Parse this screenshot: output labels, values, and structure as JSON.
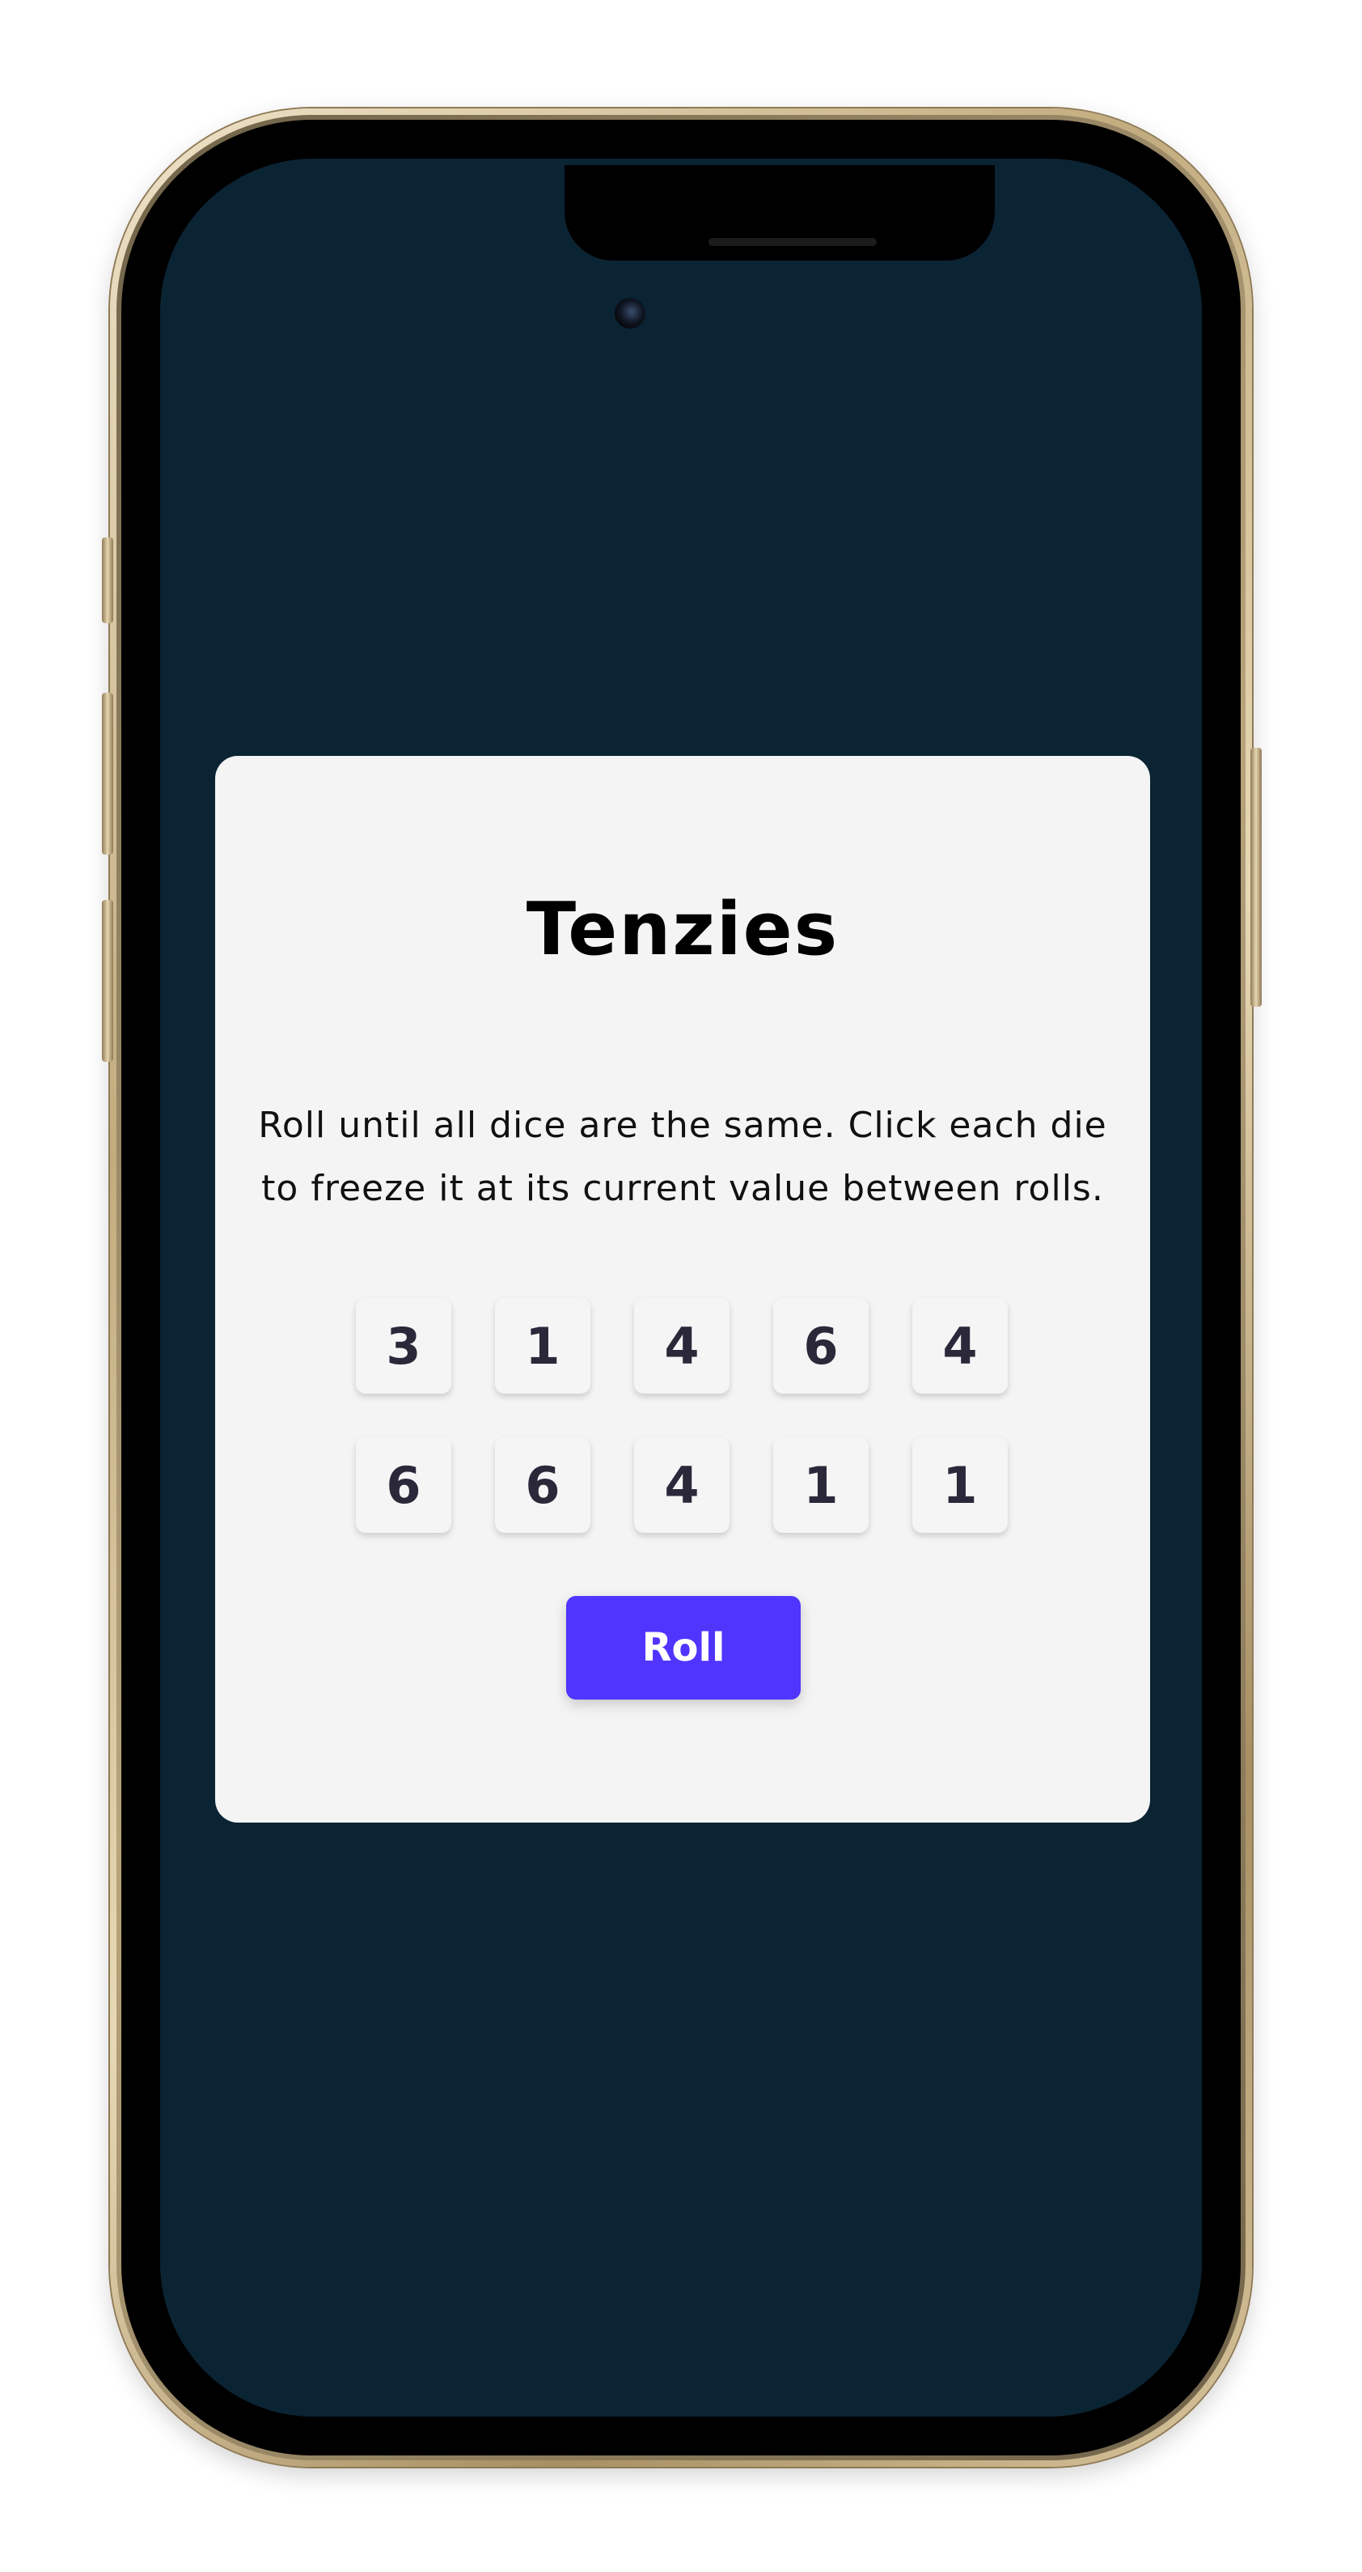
{
  "app": {
    "title": "Tenzies",
    "instructions": "Roll until all dice are the same. Click each die to freeze it at its current value between rolls.",
    "dice": [
      "3",
      "1",
      "4",
      "6",
      "4",
      "6",
      "6",
      "4",
      "1",
      "1"
    ],
    "roll_label": "Roll"
  },
  "colors": {
    "screen_background": "#0b2434",
    "card_background": "#f4f4f4",
    "die_background": "#f5f5f5",
    "die_text": "#2b283a",
    "roll_button": "#5035ff",
    "roll_button_text": "#ffffff"
  },
  "icons": {
    "camera": "front-camera-icon"
  }
}
